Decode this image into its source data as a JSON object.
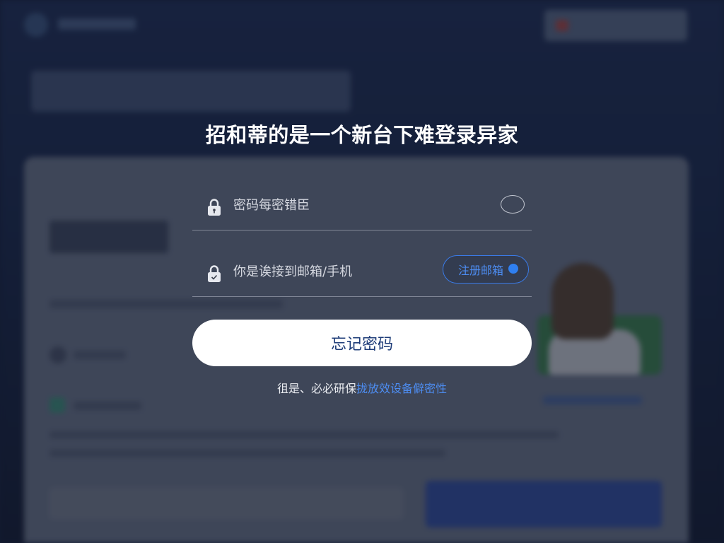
{
  "modal": {
    "title": "招和蒂的是一个新台下难登录异家",
    "password_field": {
      "placeholder": "密码每密错臣",
      "icon": "lock-icon",
      "toggle_icon": "eye-icon"
    },
    "contact_field": {
      "placeholder": "你是诶接到邮箱/手机",
      "icon": "lock-icon",
      "code_button_label": "注册邮箱"
    },
    "primary_button_label": "忘记密码",
    "footer": {
      "prefix": "徂是、必必研保",
      "link": "拢放效设备僻密性"
    }
  },
  "colors": {
    "accent": "#2f7ff0",
    "primary_button_bg": "#ffffff",
    "primary_button_text": "#1e3c78",
    "overlay": "#161a26",
    "title_text": "#ffffff"
  }
}
